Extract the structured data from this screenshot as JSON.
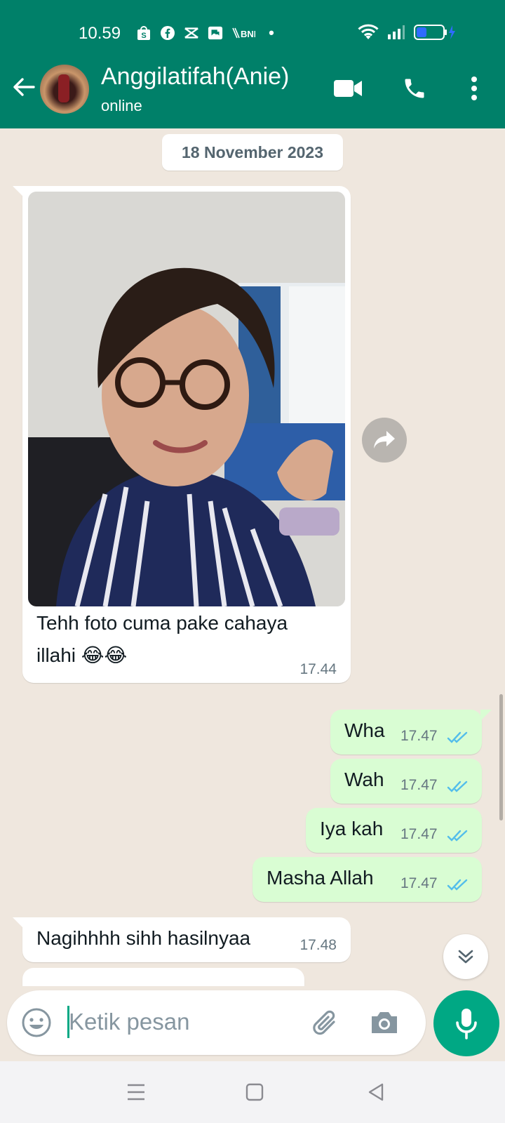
{
  "status_bar": {
    "time": "10.59",
    "bank_label": "BNI",
    "dot": "•"
  },
  "header": {
    "contact_name": "Anggilatifah(Anie)",
    "contact_status": "online"
  },
  "chat": {
    "date_chip": "18 November 2023",
    "messages": [
      {
        "dir": "in",
        "type": "image",
        "caption_line1": "Tehh foto cuma pake cahaya",
        "caption_line2": "illahi 😂😂",
        "time": "17.44"
      },
      {
        "dir": "out",
        "text": "Wha",
        "time": "17.47",
        "status": "read"
      },
      {
        "dir": "out",
        "text": "Wah",
        "time": "17.47",
        "status": "read"
      },
      {
        "dir": "out",
        "text": "Iya kah",
        "time": "17.47",
        "status": "read"
      },
      {
        "dir": "out",
        "text": "Masha Allah",
        "time": "17.47",
        "status": "read"
      },
      {
        "dir": "in",
        "text": "Nagihhhh sihh hasilnyaa",
        "time": "17.48"
      }
    ]
  },
  "composer": {
    "placeholder": "Ketik pesan"
  },
  "icons": [
    "back-arrow-icon",
    "video-call-icon",
    "voice-call-icon",
    "more-options-icon",
    "forward-icon",
    "scroll-down-icon",
    "emoji-icon",
    "attach-icon",
    "camera-icon",
    "microphone-icon"
  ],
  "colors": {
    "header": "#008069",
    "outgoing_bubble": "#d9fdd3",
    "incoming_bubble": "#ffffff",
    "chat_bg": "#efe7de",
    "accent": "#00a884",
    "read_ticks": "#53bdeb"
  }
}
